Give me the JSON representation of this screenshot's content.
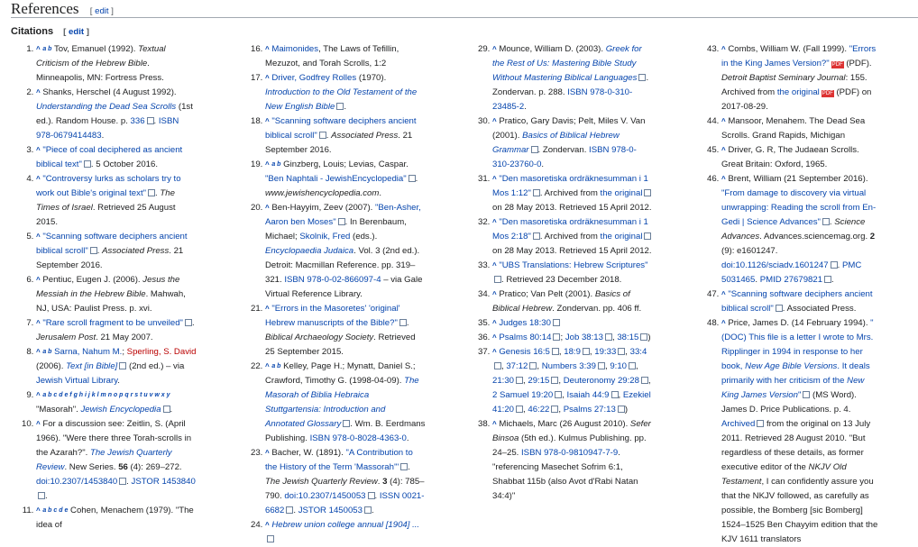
{
  "page": {
    "heading": "References",
    "edit_label": "edit",
    "subheading": "Citations"
  },
  "columns": [
    {
      "start": 1,
      "items": [
        {
          "n": 1,
          "html": "<span class='caret'>^</span> <span class='sup'>a b</span> Tov, Emanuel (1992). <i>Textual Criticism of the Hebrew Bible</i>. Minneapolis, MN: Fortress Press."
        },
        {
          "n": 2,
          "html": "<span class='caret'>^</span> Shanks, Herschel (4 August 1992). <i><a>Understanding the Dead Sea Scrolls</a></i> (1st ed.). Random House. p. <a>336</a><span class='ext'></span>. <a>ISBN 978-0679414483</a>."
        },
        {
          "n": 3,
          "html": "<span class='caret'>^</span> <a>\"Piece of coal deciphered as ancient biblical text\"</a><span class='ext'></span>. 5 October 2016."
        },
        {
          "n": 4,
          "html": "<span class='caret'>^</span> <a>\"Controversy lurks as scholars try to work out Bible's original text\"</a><span class='ext'></span>. <i>The Times of Israel</i>. Retrieved 25 August 2015."
        },
        {
          "n": 5,
          "html": "<span class='caret'>^</span> <a>\"Scanning software deciphers ancient biblical scroll\"</a><span class='ext'></span>. <i>Associated Press</i>. 21 September 2016."
        },
        {
          "n": 6,
          "html": "<span class='caret'>^</span> Pentiuc, Eugen J. (2006). <i>Jesus the Messiah in the Hebrew Bible</i>. Mahwah, NJ, USA: Paulist Press. p. xvi."
        },
        {
          "n": 7,
          "html": "<span class='caret'>^</span> <a>\"Rare scroll fragment to be unveiled\"</a><span class='ext'></span>. <i>Jerusalem Post</i>. 21 May 2007."
        },
        {
          "n": 8,
          "html": "<span class='caret'>^</span> <span class='sup'>a b</span> <a>Sarna, Nahum M.</a>; <span class='red'>Sperling, S. David</span> (2006). <i><a>Text [in Bible]</a></i><span class='ext'></span> (2nd ed.) – via <a>Jewish Virtual Library</a>."
        },
        {
          "n": 9,
          "html": "<span class='caret'>^</span> <span class='sup'>a b c d e f g h i j k l m n o p q r s t u v w x y</span><br>\"Masorah\". <a><i>Jewish Encyclopedia</i></a><span class='ext'></span>."
        },
        {
          "n": 10,
          "html": "<span class='caret'>^</span> For a discussion see: Zeitlin, S. (April 1966). \"Were there three Torah-scrolls in the Azarah?\". <i><a>The Jewish Quarterly Review</a></i>. New Series. <b>56</b> (4): 269–272. <a>doi:10.2307/1453840</a><span class='ext'></span>. <a>JSTOR 1453840</a><span class='ext'></span>."
        },
        {
          "n": 11,
          "html": "<span class='caret'>^</span> <span class='sup'>a b c d e</span> Cohen, Menachem (1979). \"The idea of"
        }
      ]
    },
    {
      "start": 16,
      "items": [
        {
          "n": 16,
          "html": "<span class='caret'>^</span> <a>Maimonides</a>, The Laws of Tefillin, Mezuzot, and Torah Scrolls, 1:2"
        },
        {
          "n": 17,
          "html": "<span class='caret'>^</span> <a>Driver, Godfrey Rolles</a> (1970). <i><a>Introduction to the Old Testament of the New English Bible</a></i><span class='ext'></span>."
        },
        {
          "n": 18,
          "html": "<span class='caret'>^</span> <a>\"Scanning software deciphers ancient biblical scroll\"</a><span class='ext'></span>. <i>Associated Press</i>. 21 September 2016."
        },
        {
          "n": 19,
          "html": "<span class='caret'>^</span> <span class='sup'>a b</span> Ginzberg, Louis; Levias, Caspar. <a>\"Ben Naphtali - JewishEncyclopedia\"</a><span class='ext'></span>. <i>www.jewishencyclopedia.com</i>."
        },
        {
          "n": 20,
          "html": "<span class='caret'>^</span> Ben-Hayyim, Zeev (2007). <a>\"Ben-Asher, Aaron ben Moses\"</a><span class='ext'></span>. In Berenbaum, Michael; <a>Skolnik, Fred</a> (eds.). <i><a>Encyclopaedia Judaica</a></i>. Vol. 3 (2nd ed.). Detroit: Macmillan Reference. pp. 319–321. <a>ISBN 978-0-02-866097-4</a> – via Gale Virtual Reference Library."
        },
        {
          "n": 21,
          "html": "<span class='caret'>^</span> <a>\"Errors in the Masoretes' 'original' Hebrew manuscripts of the Bible?\"</a><span class='ext'></span>. <i>Biblical Archaeology Society</i>. Retrieved 25 September 2015."
        },
        {
          "n": 22,
          "html": "<span class='caret'>^</span> <span class='sup'>a b</span> Kelley, Page H.; Mynatt, Daniel S.; Crawford, Timothy G. (1998-04-09). <i><a>The Masorah of Biblia Hebraica Stuttgartensia: Introduction and Annotated Glossary</a></i><span class='ext'></span>. Wm. B. Eerdmans Publishing. <a>ISBN 978-0-8028-4363-0</a>."
        },
        {
          "n": 23,
          "html": "<span class='caret'>^</span> Bacher, W. (1891). <a>\"A Contribution to the History of the Term 'Massorah'\"</a><span class='ext'></span>. <i>The Jewish Quarterly Review</i>. <b>3</b> (4): 785–790. <a>doi:10.2307/1450053</a><span class='ext'></span>. <a>ISSN 0021-6682</a><span class='ext'></span>. <a>JSTOR 1450053</a><span class='ext'></span>."
        },
        {
          "n": 24,
          "html": "<span class='caret'>^</span> <a><i>Hebrew union college annual [1904] ...</i></a><span class='ext'></span>"
        }
      ]
    },
    {
      "start": 29,
      "items": [
        {
          "n": 29,
          "html": "<span class='caret'>^</span> Mounce, William D. (2003). <i><a>Greek for the Rest of Us: Mastering Bible Study Without Mastering Biblical Languages</a></i><span class='ext'></span>. Zondervan. p. 288. <a>ISBN 978-0-310-23485-2</a>."
        },
        {
          "n": 30,
          "html": "<span class='caret'>^</span> Pratico, Gary Davis; Pelt, Miles V. Van (2001). <i><a>Basics of Biblical Hebrew Grammar</a></i><span class='ext'></span>. Zondervan. <a>ISBN 978-0-310-23760-0</a>."
        },
        {
          "n": 31,
          "html": "<span class='caret'>^</span> <a>\"Den masoretiska ordräknesumman i 1 Mos 1:12\"</a><span class='ext'></span>. Archived from <a>the original</a><span class='ext'></span> on 28 May 2013. Retrieved 15 April 2012."
        },
        {
          "n": 32,
          "html": "<span class='caret'>^</span> <a>\"Den masoretiska ordräknesumman i 1 Mos 2:18\"</a><span class='ext'></span>. Archived from <a>the original</a><span class='ext'></span> on 28 May 2013. Retrieved 15 April 2012."
        },
        {
          "n": 33,
          "html": "<span class='caret'>^</span> <a>\"UBS Translations: Hebrew Scriptures\"</a><span class='ext'></span>. Retrieved 23 December 2018."
        },
        {
          "n": 34,
          "html": "<span class='caret'>^</span> Pratico; Van Pelt (2001). <i>Basics of Biblical Hebrew</i>. Zondervan. pp. 406 ff."
        },
        {
          "n": 35,
          "html": "<span class='caret'>^</span> <a>Judges 18:30</a><span class='ext'></span>"
        },
        {
          "n": 36,
          "html": "<span class='caret'>^</span> <a>Psalms 80:14</a><span class='ext'></span>; <a>Job 38:13</a><span class='ext'></span>, <a>38:15</a><span class='ext'></span>)"
        },
        {
          "n": 37,
          "html": "<span class='caret'>^</span> <a>Genesis 16:5</a><span class='ext'></span>, <a>18:9</a><span class='ext'></span>, <a>19:33</a><span class='ext'></span>, <a>33:4</a><span class='ext'></span>, <a>37:12</a><span class='ext'></span>, <a>Numbers 3:39</a><span class='ext'></span>, <a>9:10</a><span class='ext'></span>, <a>21:30</a><span class='ext'></span>, <a>29:15</a><span class='ext'></span>, <a>Deuteronomy 29:28</a><span class='ext'></span>, <a>2 Samuel 19:20</a><span class='ext'></span>, <a>Isaiah 44:9</a><span class='ext'></span>, <a>Ezekiel 41:20</a><span class='ext'></span>, <a>46:22</a><span class='ext'></span>, <a>Psalms 27:13</a><span class='ext'></span>)"
        },
        {
          "n": 38,
          "html": "<span class='caret'>^</span> Michaels, Marc (26 August 2010). <i>Sefer Binsoa</i> (5th ed.). Kulmus Publishing. pp. 24–25. <a>ISBN 978-0-9810947-7-9</a>. \"referencing Masechet Sofrim 6:1, Shabbat 115b (also Avot d'Rabi Natan 34:4)\""
        }
      ]
    },
    {
      "start": 43,
      "items": [
        {
          "n": 43,
          "html": "<span class='caret'>^</span> Combs, William W. (Fall 1999). <a>\"Errors in the King James Version?\"</a><span class='pdf'>PDF</span> (PDF). <i>Detroit Baptist Seminary Journal</i>: 155. Archived from <a>the original</a><span class='pdf'>PDF</span> (PDF) on 2017-08-29."
        },
        {
          "n": 44,
          "html": "<span class='caret'>^</span> Mansoor, Menahem. The Dead Sea Scrolls. Grand Rapids, Michigan"
        },
        {
          "n": 45,
          "html": "<span class='caret'>^</span> Driver, G. R, The Judaean Scrolls. Great Britain: Oxford, 1965."
        },
        {
          "n": 46,
          "html": "<span class='caret'>^</span> Brent, William (21 September 2016). <a>\"From damage to discovery via virtual unwrapping: Reading the scroll from En-Gedi | Science Advances\"</a><span class='ext'></span>. <i>Science Advances</i>. Advances.sciencemag.org. <b>2</b> (9): e1601247. <a>doi:10.1126/sciadv.1601247</a><span class='ext'></span>. <a>PMC 5031465</a>. <a>PMID 27679821</a><span class='ext'></span>."
        },
        {
          "n": 47,
          "html": "<span class='caret'>^</span> <a>\"Scanning software deciphers ancient biblical scroll\"</a><span class='ext'></span>. Associated Press."
        },
        {
          "n": 48,
          "html": "<span class='caret'>^</span> Price, James D. (14 February 1994). <a>\"(DOC) This file is a letter I wrote to Mrs. Ripplinger in 1994 in response to her book, <i>New Age Bible Versions</i>. It deals primarily with her criticism of the <i>New King James Version</i>\"</a><span class='ext'></span> (MS Word). James D. Price Publications. p. 4. <a>Archived</a><span class='ext'></span> from the original on 13 July 2011. Retrieved 28 August 2010. \"But regardless of these details, as former executive editor of the <i>NKJV Old Testament</i>, I can confidently assure you that the NKJV followed, as carefully as possible, the Bomberg [sic Bomberg] 1524–1525 Ben Chayyim edition that the KJV 1611 translators"
        }
      ]
    }
  ]
}
